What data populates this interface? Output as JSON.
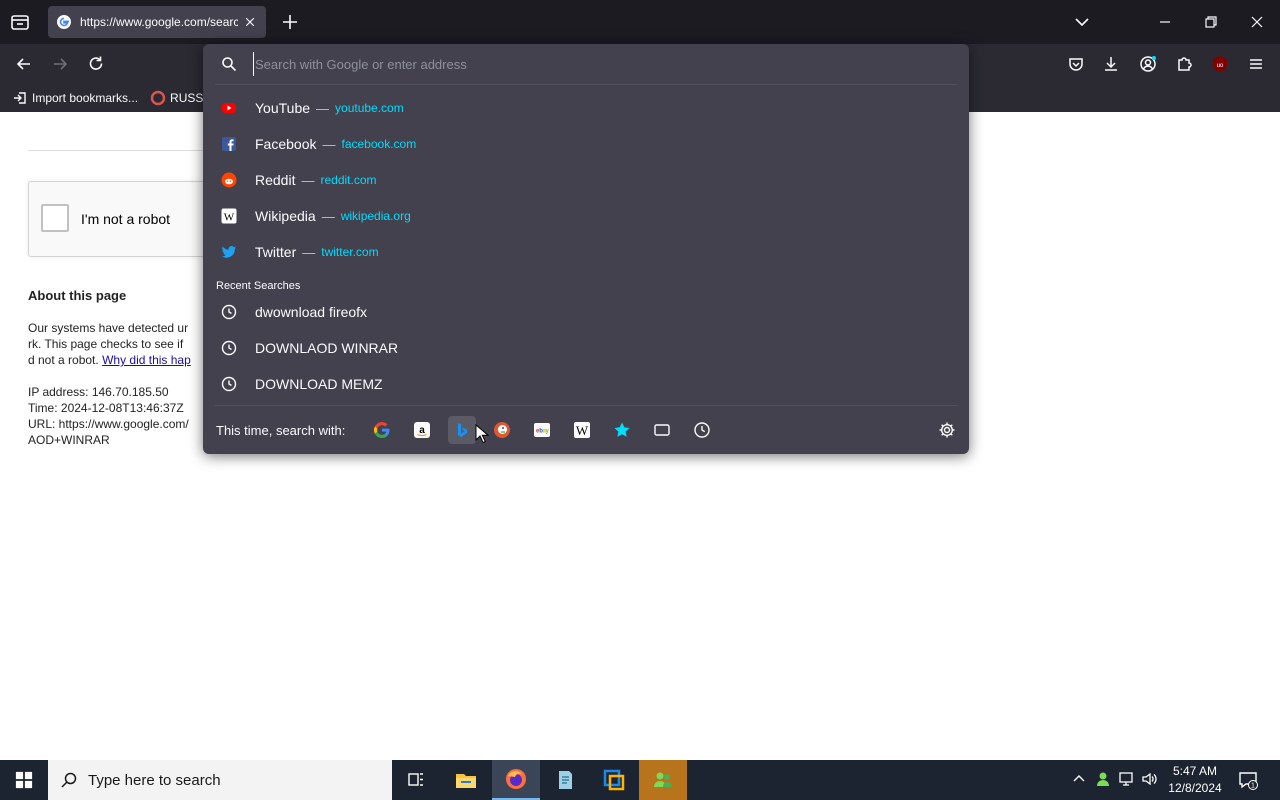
{
  "browser": {
    "tab": {
      "title": "https://www.google.com/search",
      "favicon": "google-icon"
    },
    "bookmarks": [
      {
        "label": "Import bookmarks...",
        "icon": "import-icon"
      },
      {
        "label": "RUSSI",
        "icon": "bookmark-favicon"
      }
    ]
  },
  "urlbar": {
    "placeholder": "Search with Google or enter address",
    "value": "",
    "top_sites": [
      {
        "name": "YouTube",
        "dash": "—",
        "url": "youtube.com",
        "icon": "youtube-icon"
      },
      {
        "name": "Facebook",
        "dash": "—",
        "url": "facebook.com",
        "icon": "facebook-icon"
      },
      {
        "name": "Reddit",
        "dash": "—",
        "url": "reddit.com",
        "icon": "reddit-icon"
      },
      {
        "name": "Wikipedia",
        "dash": "—",
        "url": "wikipedia.org",
        "icon": "wikipedia-icon"
      },
      {
        "name": "Twitter",
        "dash": "—",
        "url": "twitter.com",
        "icon": "twitter-icon"
      }
    ],
    "recent_label": "Recent Searches",
    "recent": [
      {
        "text": "dwownload fireofx"
      },
      {
        "text": "DOWNLAOD WINRAR"
      },
      {
        "text": "DOWNLOAD MEMZ"
      }
    ],
    "one_off_label": "This time, search with:",
    "engines": [
      "google-icon",
      "amazon-icon",
      "bing-icon",
      "duckduckgo-icon",
      "ebay-icon",
      "wikipedia-icon",
      "bookmarks-star-icon",
      "tabs-icon",
      "history-icon"
    ]
  },
  "page": {
    "recaptcha_label": "I'm not a robot",
    "about_title": "About this page",
    "about_lines": [
      "Our systems have detected ur",
      "rk. This page checks to see if",
      "d not a robot. "
    ],
    "about_link": "Why did this hap",
    "ip_line": "IP address: 146.70.185.50",
    "time_line": "Time: 2024-12-08T13:46:37Z",
    "url_line": "URL: https://www.google.com/",
    "query_line": "AOD+WINRAR"
  },
  "taskbar": {
    "search_placeholder": "Type here to search",
    "time": "5:47 AM",
    "date": "12/8/2024",
    "notification_count": "1"
  },
  "colors": {
    "accent_link": "#00ddff",
    "dropdown_bg": "#42414d",
    "toolbar_bg": "#2b2a33",
    "tabstrip_bg": "#1c1b22"
  }
}
